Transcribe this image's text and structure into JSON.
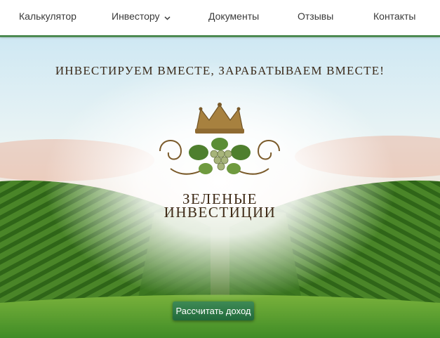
{
  "nav": {
    "items": [
      {
        "label": "Калькулятор"
      },
      {
        "label": "Инвестору",
        "has_dropdown": true
      },
      {
        "label": "Документы"
      },
      {
        "label": "Отзывы"
      },
      {
        "label": "Контакты"
      }
    ],
    "accent_color": "#4c8a52"
  },
  "hero": {
    "headline": "ИНВЕСТИРУЕМ ВМЕСТЕ, ЗАРАБАТЫВАЕМ ВМЕСТЕ!",
    "brand_line1": "ЗЕЛЕНЫЕ",
    "brand_line2": "ИНВЕСТИЦИИ",
    "cta_label": "Рассчитать доход",
    "logo_icon": "crown-grape-vine-logo-icon",
    "cta_color": "#2a7444"
  }
}
